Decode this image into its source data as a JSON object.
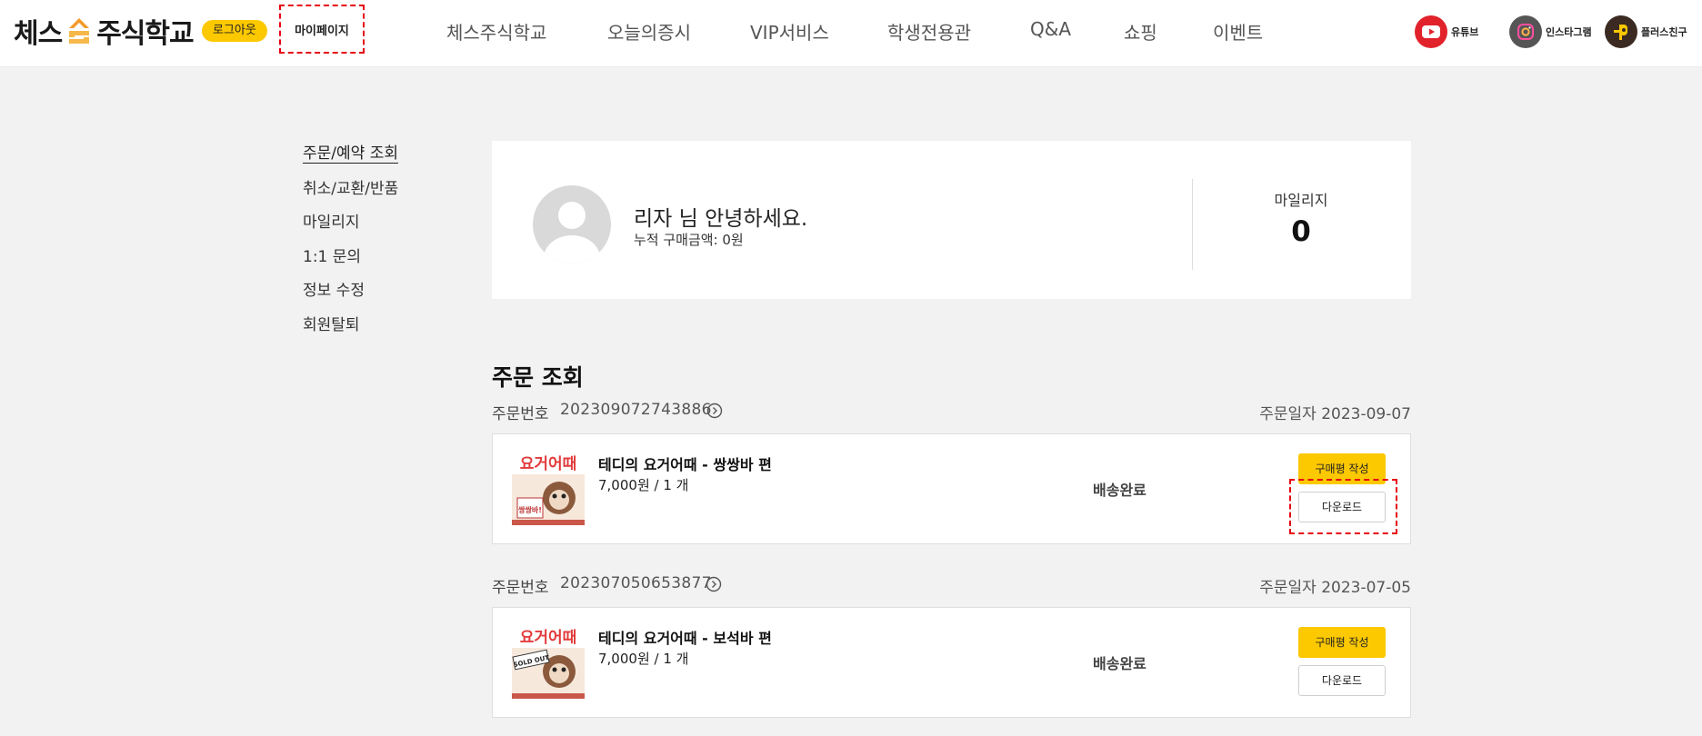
{
  "header": {
    "logo_left": "체스",
    "logo_right": "주식학교",
    "logout_label": "로그아웃",
    "mypage_label": "마이페이지",
    "nav": [
      "체스주식학교",
      "오늘의증시",
      "VIP서비스",
      "학생전용관",
      "Q&A",
      "쇼핑",
      "이벤트"
    ],
    "social": [
      {
        "label": "유튜브",
        "icon": "youtube-icon",
        "color": "#e1222b"
      },
      {
        "label": "인스타그램",
        "icon": "instagram-icon",
        "color": "#555555"
      },
      {
        "label": "플러스친구",
        "icon": "kakao-plus-icon",
        "color": "#3a2a22"
      }
    ]
  },
  "sidebar": {
    "items": [
      "주문/예약 조회",
      "취소/교환/반품",
      "마일리지",
      "1:1 문의",
      "정보 수정",
      "회원탈퇴"
    ]
  },
  "profile": {
    "greeting": "리자 님 안녕하세요.",
    "total_purchase": "누적 구매금액: 0원",
    "mileage_label": "마일리지",
    "mileage_value": "0"
  },
  "orders": {
    "title": "주문 조회",
    "order_no_label": "주문번호",
    "order_date_label": "주문일자",
    "list": [
      {
        "order_no": "202309072743886",
        "date": "2023-09-07",
        "product": "테디의 요거어때 - 쌍쌍바 편",
        "price": "7,000원 / 1 개",
        "status": "배송완료",
        "review_label": "구매평 작성",
        "download_label": "다운로드",
        "thumb_title": "요거어때",
        "thumb_caption": "쌍쌍바!"
      },
      {
        "order_no": "202307050653877",
        "date": "2023-07-05",
        "product": "테디의 요거어때 - 보석바 편",
        "price": "7,000원 / 1 개",
        "status": "배송완료",
        "review_label": "구매평 작성",
        "download_label": "다운로드",
        "thumb_title": "요거어때",
        "thumb_caption": "SOLD OUT"
      }
    ]
  },
  "colors": {
    "accent_yellow": "#fcc800",
    "highlight_red": "#e60012",
    "background": "#f2f2f2"
  }
}
